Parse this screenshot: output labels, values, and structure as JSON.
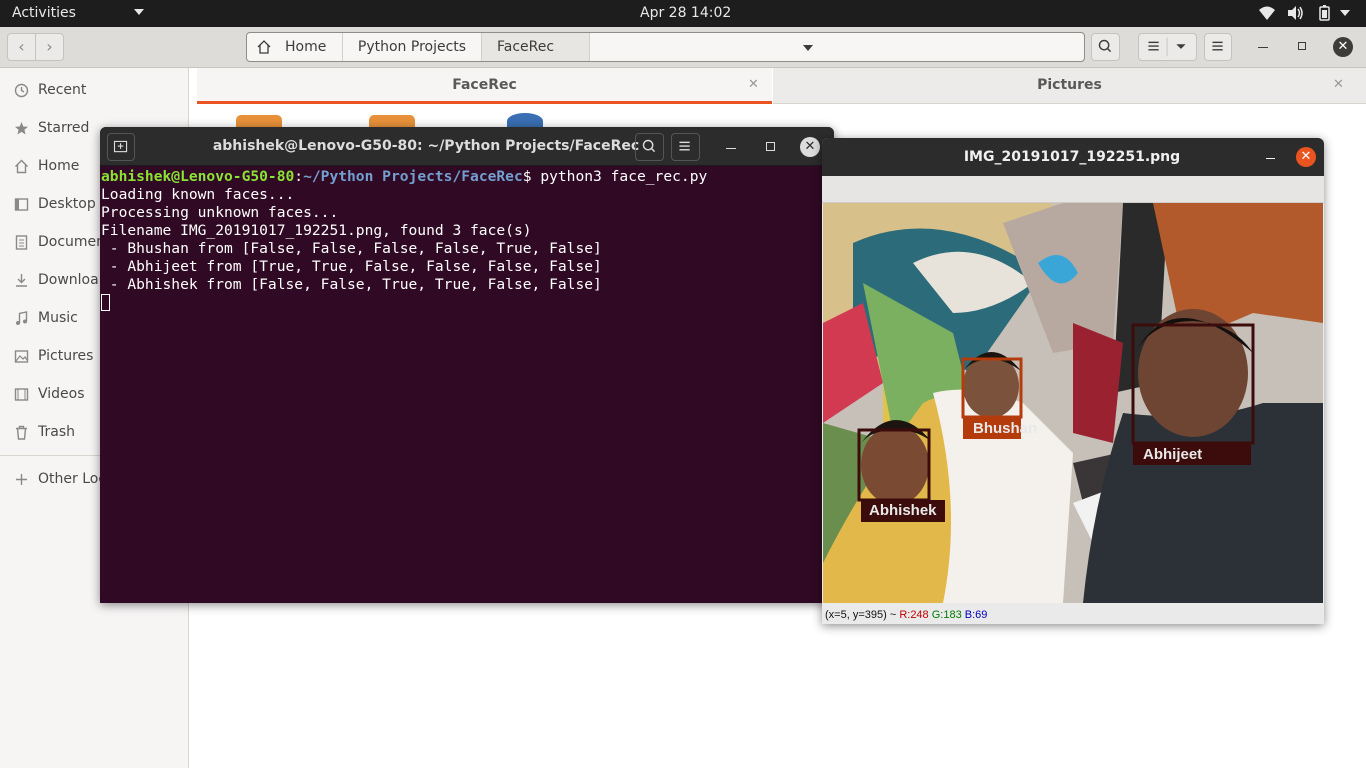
{
  "topbar": {
    "activities": "Activities",
    "clock": "Apr 28  14:02"
  },
  "files": {
    "path": [
      "Home",
      "Python Projects",
      "FaceRec"
    ],
    "sidebar": [
      {
        "label": "Recent",
        "icon": "clock-icon"
      },
      {
        "label": "Starred",
        "icon": "star-icon"
      },
      {
        "label": "Home",
        "icon": "home-icon"
      },
      {
        "label": "Desktop",
        "icon": "desktop-icon"
      },
      {
        "label": "Documen",
        "icon": "document-icon"
      },
      {
        "label": "Downloa",
        "icon": "download-icon"
      },
      {
        "label": "Music",
        "icon": "music-icon"
      },
      {
        "label": "Pictures",
        "icon": "picture-icon"
      },
      {
        "label": "Videos",
        "icon": "video-icon"
      },
      {
        "label": "Trash",
        "icon": "trash-icon"
      },
      {
        "label": "Other Loc",
        "icon": "plus-icon"
      }
    ],
    "tabs": [
      "FaceRec",
      "Pictures"
    ]
  },
  "terminal": {
    "title": "abhishek@Lenovo-G50-80: ~/Python Projects/FaceRec",
    "prompt_user": "abhishek@Lenovo-G50-80",
    "prompt_sep": ":",
    "prompt_path": "~/Python Projects/FaceRec",
    "prompt_end": "$ ",
    "command": "python3 face_rec.py",
    "output": [
      "Loading known faces...",
      "Processing unknown faces...",
      "Filename IMG_20191017_192251.png, found 3 face(s)",
      " - Bhushan from [False, False, False, False, True, False]",
      " - Abhijeet from [True, True, False, False, False, False]",
      " - Abhishek from [False, False, True, True, False, False]"
    ]
  },
  "viewer": {
    "title": "IMG_20191017_192251.png",
    "faces": [
      {
        "name": "Bhushan",
        "color": "#b43c0c"
      },
      {
        "name": "Abhijeet",
        "color": "#3c0c0c"
      },
      {
        "name": "Abhishek",
        "color": "#3c0c0c"
      }
    ],
    "status_xy": "(x=5, y=395) ~",
    "status_r": "R:248",
    "status_g": "G:183",
    "status_b": "B:69"
  },
  "colors": {
    "accent": "#e95420",
    "terminal_bg": "#300a24",
    "prompt_user": "#8ae234",
    "prompt_path": "#729fcf"
  }
}
